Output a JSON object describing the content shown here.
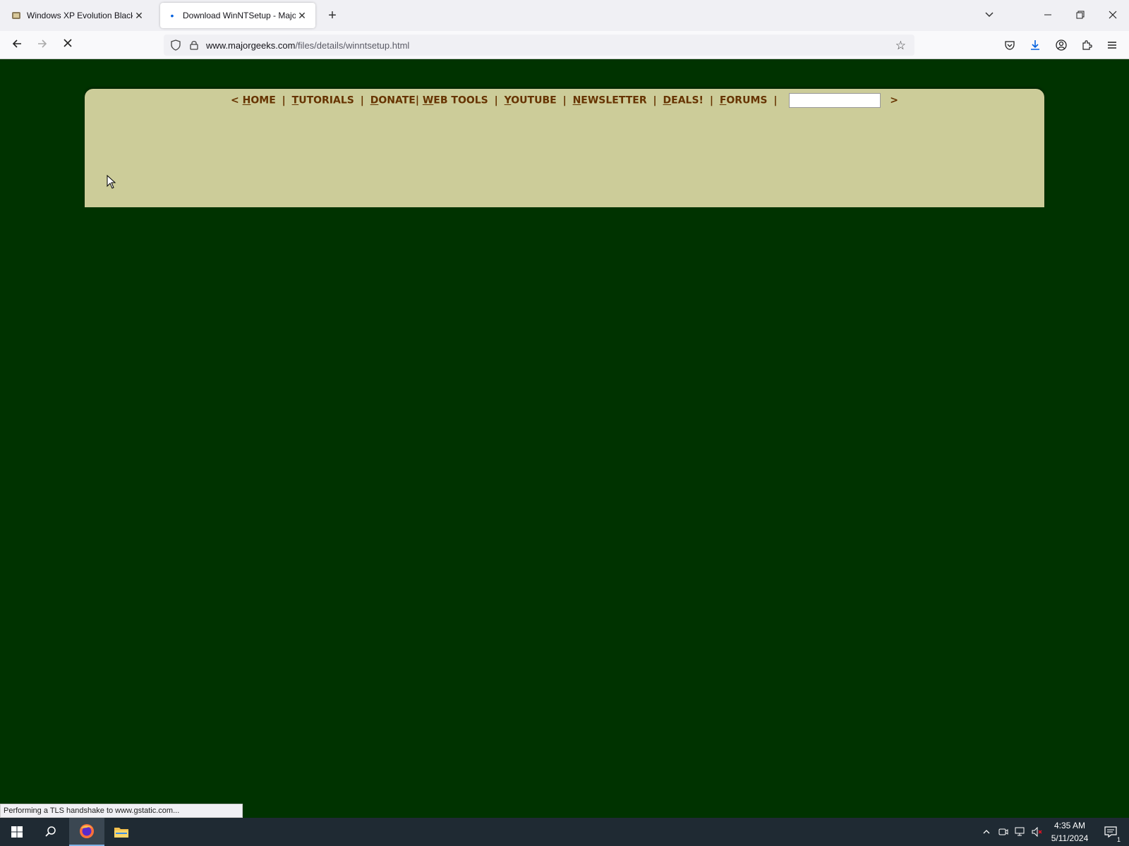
{
  "browser": {
    "tabs": [
      {
        "title": "Windows XP Evolution Black SP",
        "close": "✕"
      },
      {
        "title": "Download WinNTSetup - Major",
        "close": "✕"
      }
    ],
    "new_tab": "+",
    "url_domain": "www.majorgeeks.com",
    "url_path": "/files/details/winntsetup.html"
  },
  "site": {
    "nav": {
      "open": "<",
      "close": ">",
      "links": [
        {
          "first": "H",
          "rest": "OME"
        },
        {
          "first": "T",
          "rest": "UTORIALS"
        },
        {
          "first": "D",
          "rest": "ONATE"
        },
        {
          "first": "W",
          "rest": "EB TOOLS"
        },
        {
          "first": "Y",
          "rest": "OUTUBE"
        },
        {
          "first": "N",
          "rest": "EWSLETTER"
        },
        {
          "first": "D",
          "rest": "EALS!"
        },
        {
          "first": "F",
          "rest": "ORUMS"
        }
      ],
      "search_value": ""
    },
    "colors": {
      "background": "#003300",
      "panel": "#cccc99",
      "link": "#663300"
    }
  },
  "status_bar": {
    "text": "Performing a TLS handshake to www.gstatic.com..."
  },
  "taskbar": {
    "time": "4:35 AM",
    "date": "5/11/2024",
    "notification_count": "1"
  }
}
